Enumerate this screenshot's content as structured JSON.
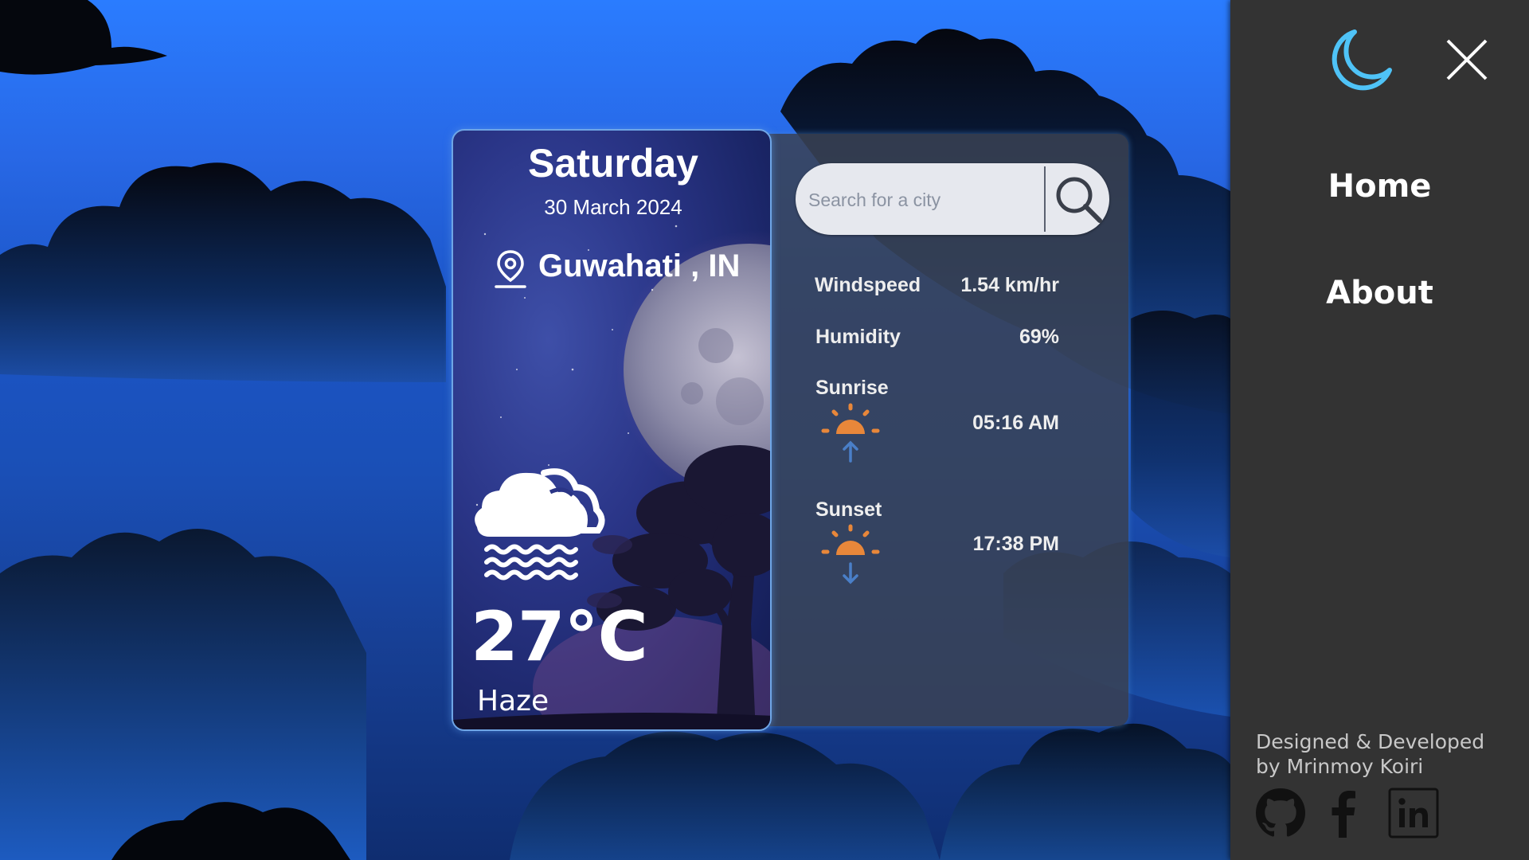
{
  "weather_card": {
    "day": "Saturday",
    "date": "30 March 2024",
    "location": "Guwahati , IN",
    "temperature": "27°C",
    "condition": "Haze",
    "condition_icon": "haze-cloud-icon"
  },
  "search": {
    "placeholder": "Search for a city",
    "value": ""
  },
  "details": {
    "windspeed_label": "Windspeed",
    "windspeed_value": "1.54 km/hr",
    "humidity_label": "Humidity",
    "humidity_value": "69%",
    "sunrise_label": "Sunrise",
    "sunrise_value": "05:16 AM",
    "sunset_label": "Sunset",
    "sunset_value": "17:38 PM"
  },
  "side_menu": {
    "theme_icon": "moon-icon",
    "close_icon": "close-icon",
    "links": [
      "Home",
      "About"
    ],
    "credit_line1": "Designed & Developed",
    "credit_line2": "by Mrinmoy Koiri",
    "socials": [
      "github-icon",
      "facebook-icon",
      "linkedin-icon"
    ]
  },
  "colors": {
    "accent_moon": "#4fc3f7",
    "sun_orange": "#e8873a",
    "arrow_blue": "#4a7fc8",
    "menu_bg": "#333333"
  }
}
